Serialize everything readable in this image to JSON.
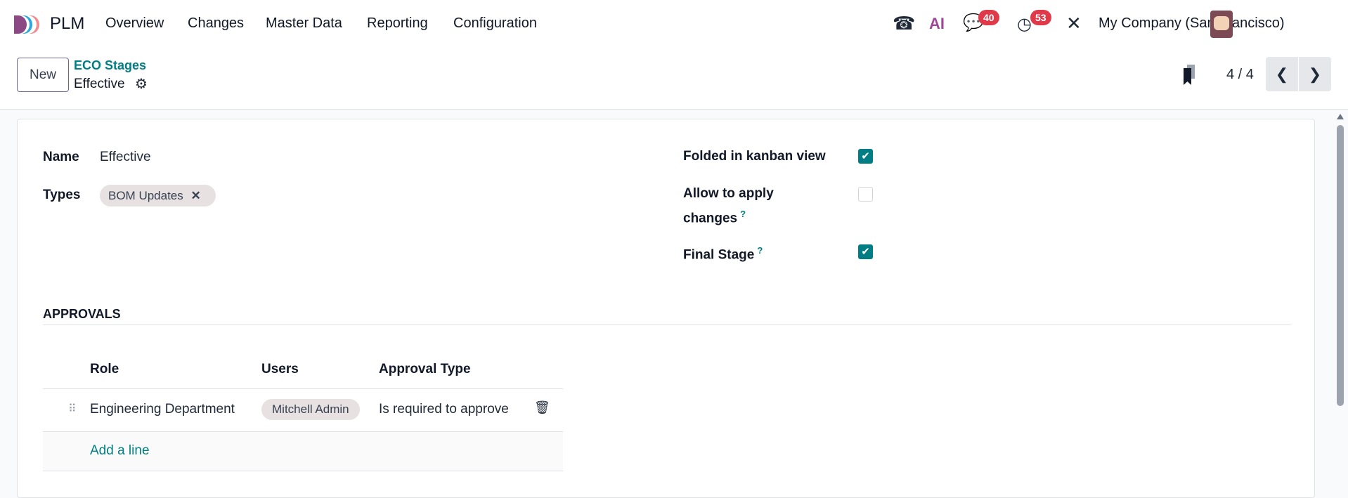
{
  "navbar": {
    "app_name": "PLM",
    "menu": [
      "Overview",
      "Changes",
      "Master Data",
      "Reporting",
      "Configuration"
    ],
    "messages_count": "40",
    "activities_count": "53",
    "company": "My Company (San Francisco)",
    "ai_label": "AI"
  },
  "control_panel": {
    "new_label": "New",
    "breadcrumb_parent": "ECO Stages",
    "breadcrumb_current": "Effective",
    "pager": "4 / 4"
  },
  "form": {
    "name_label": "Name",
    "name_value": "Effective",
    "types_label": "Types",
    "types_tags": [
      "BOM Updates"
    ],
    "folded_label": "Folded in kanban view",
    "folded_checked": true,
    "allow_label_1": "Allow to apply",
    "allow_label_2": "changes",
    "allow_checked": false,
    "final_label": "Final Stage",
    "final_checked": true,
    "help_mark": "?",
    "approvals_title": "APPROVALS",
    "table": {
      "headers": [
        "Role",
        "Users",
        "Approval Type"
      ],
      "rows": [
        {
          "role": "Engineering Department",
          "users": "Mitchell Admin",
          "approval_type": "Is required to approve"
        }
      ],
      "add_line": "Add a line"
    }
  },
  "colors": {
    "accent": "#017e84",
    "badge": "#e0394a",
    "brand": "#71639e"
  }
}
